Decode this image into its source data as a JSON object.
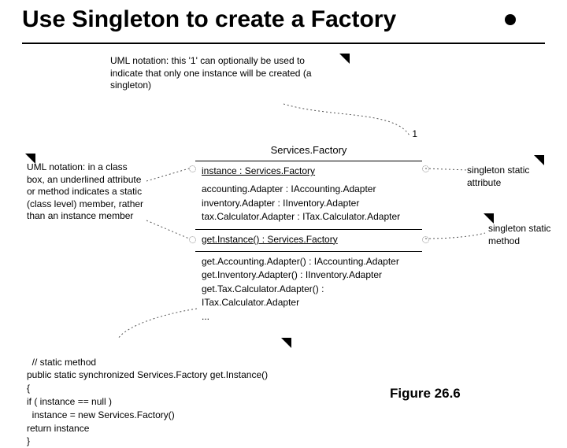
{
  "title": "Use Singleton to create a Factory",
  "notes": {
    "top": "UML notation: this '1' can optionally be used to indicate that only one instance will be created (a singleton)",
    "left": "UML notation: in a class box, an underlined attribute or method indicates a static (class level) member, rather than an instance member",
    "rightA": "singleton static attribute",
    "rightB": "singleton static method"
  },
  "uml": {
    "name": "Services.Factory",
    "count": "1",
    "attr_static": "instance : Services.Factory",
    "attrs": [
      "accounting.Adapter : IAccounting.Adapter",
      "inventory.Adapter : IInventory.Adapter",
      "tax.Calculator.Adapter : ITax.Calculator.Adapter"
    ],
    "method_static": "get.Instance() : Services.Factory",
    "methods": [
      "get.Accounting.Adapter() : IAccounting.Adapter",
      "get.Inventory.Adapter() : IInventory.Adapter",
      "get.Tax.Calculator.Adapter() : ITax.Calculator.Adapter",
      "..."
    ]
  },
  "code": "// static method\npublic static synchronized Services.Factory get.Instance()\n{\nif ( instance == null )\n  instance = new Services.Factory()\nreturn instance\n}",
  "figure": "Figure 26.6"
}
